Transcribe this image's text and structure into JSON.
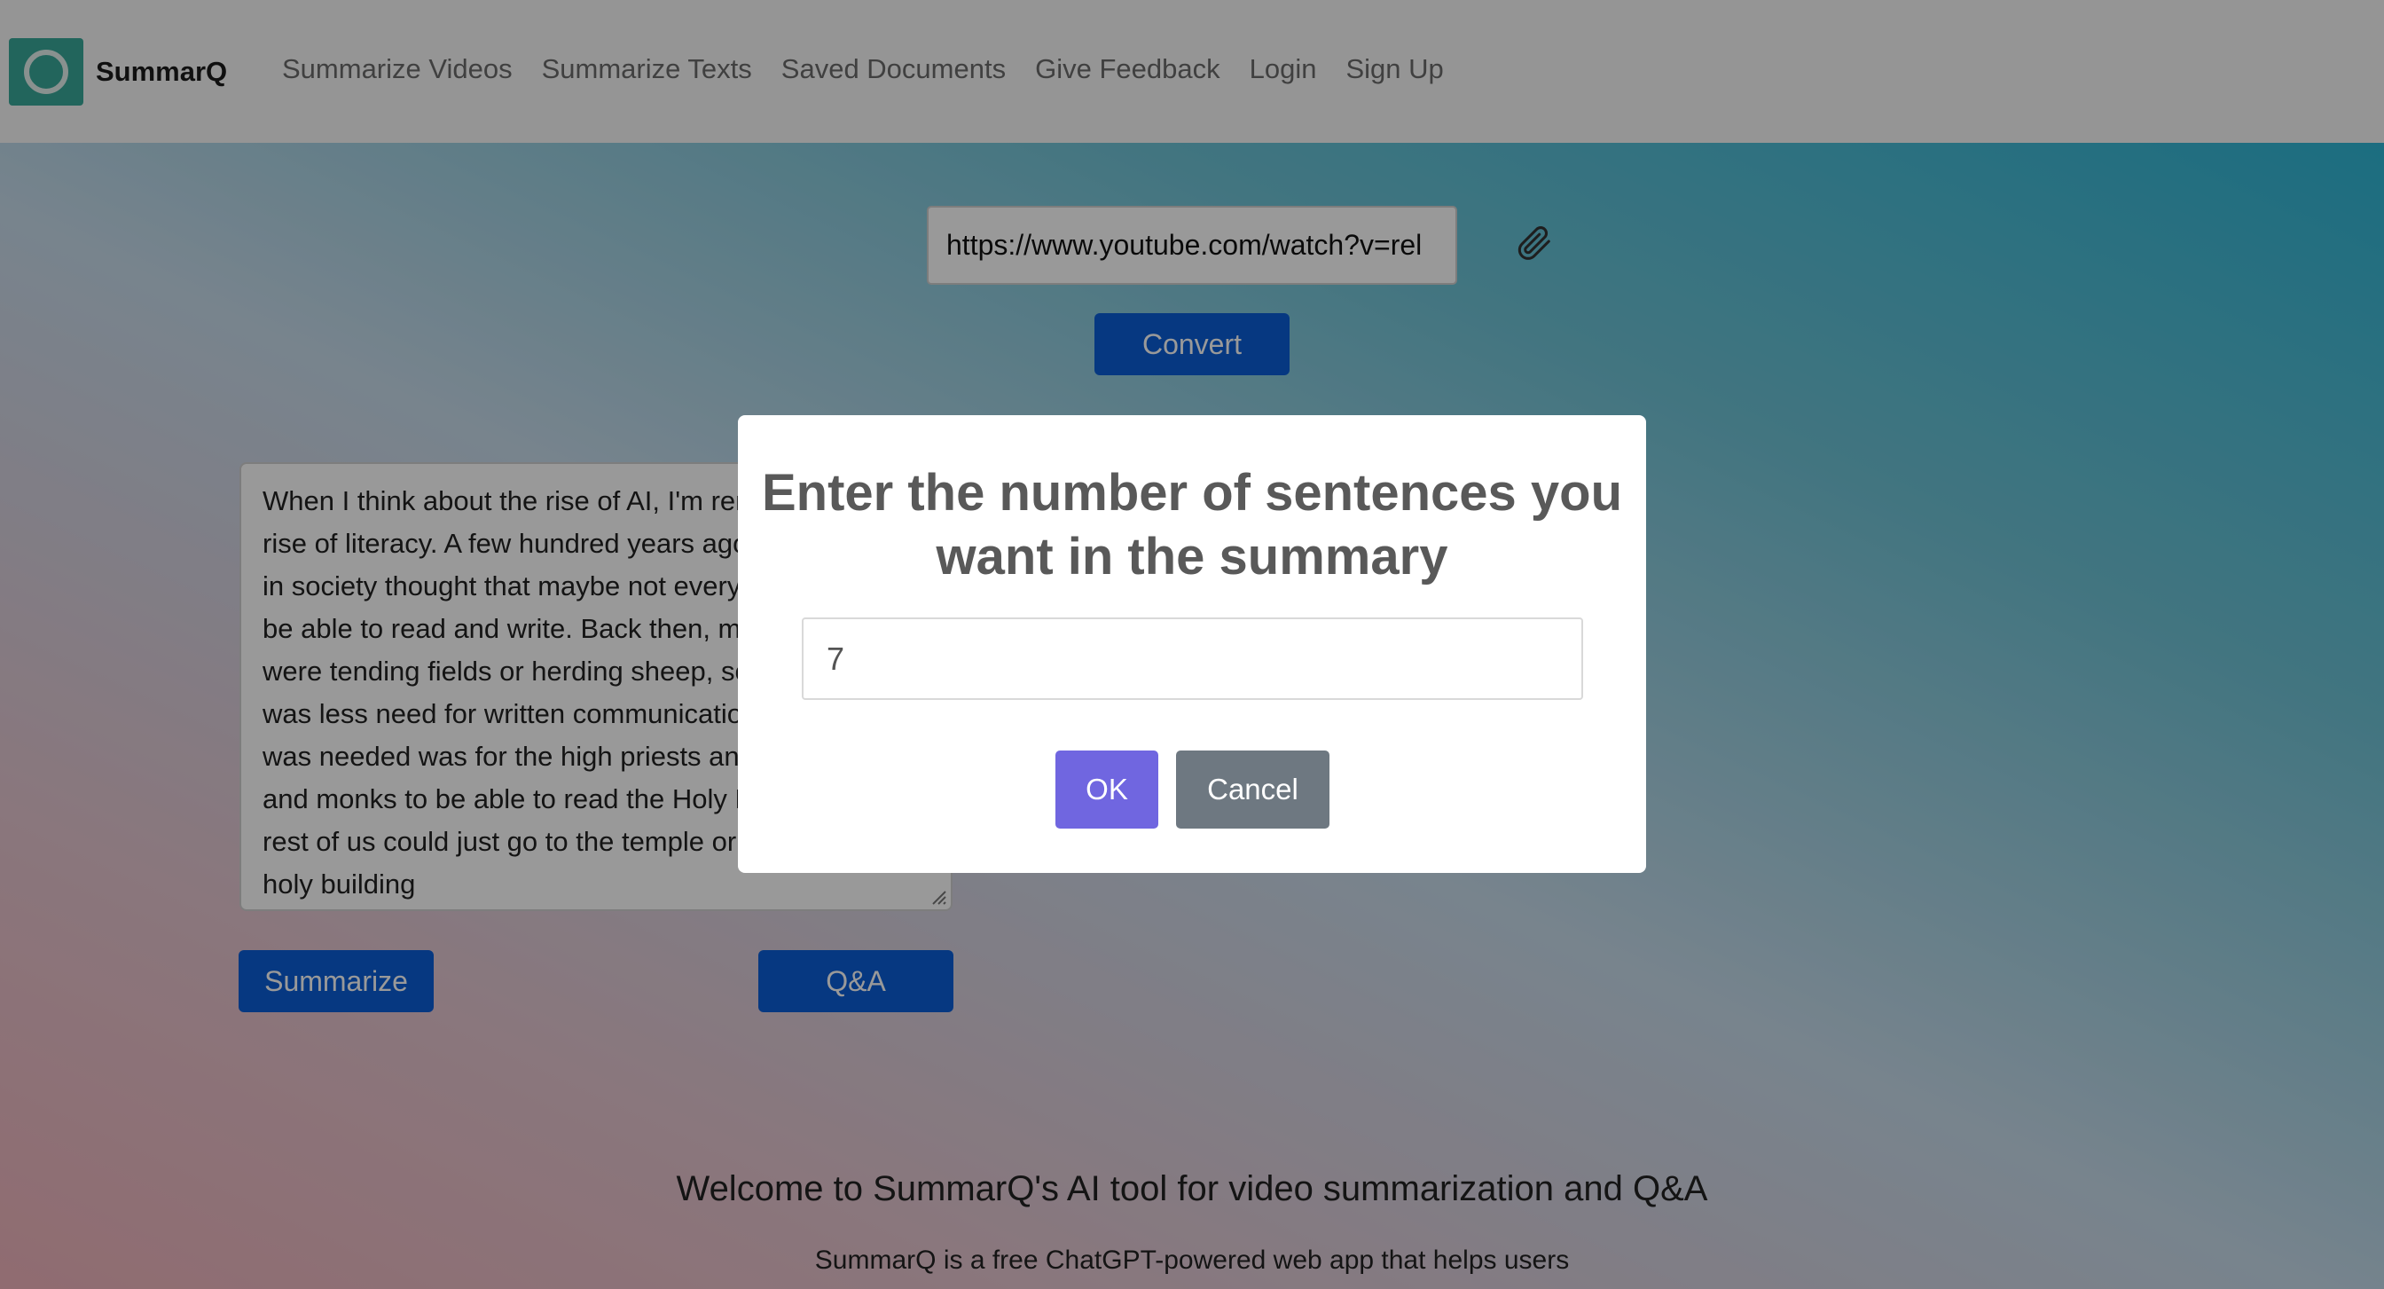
{
  "nav": {
    "brand": "SummarQ",
    "links": [
      "Summarize Videos",
      "Summarize Texts",
      "Saved Documents",
      "Give Feedback",
      "Login",
      "Sign Up"
    ]
  },
  "url_input": {
    "value": "https://www.youtube.com/watch?v=rel"
  },
  "convert_label": "Convert",
  "transcript": "When I think about the rise of AI, I'm reminded of the rise of literacy. A few hundred years ago, many people in society thought that maybe not everyone needed to be able to read and write. Back then, many people were tending fields or herding sheep, so maybe there was less need for written communication. And all that was needed was for the high priests and priestesses and monks to be able to read the Holy Book, and the rest of us could just go to the temple or church or the holy building",
  "summarize_label": "Summarize",
  "qa_label": "Q&A",
  "welcome": {
    "title": "Welcome to SummarQ's AI tool for video summarization and Q&A",
    "subtitle": "SummarQ is a free ChatGPT-powered web app that helps users"
  },
  "modal": {
    "title": "Enter the number of sentences you want in the summary",
    "input_value": "7",
    "ok_label": "OK",
    "cancel_label": "Cancel"
  },
  "icons": {
    "logo": "circle-logo-icon",
    "attach": "paperclip-icon",
    "resize": "resize-grip-icon"
  },
  "colors": {
    "primary": "#0b5ed7",
    "logo": "#3aa89a",
    "ok": "#7066e0",
    "cancel": "#6e7881"
  }
}
